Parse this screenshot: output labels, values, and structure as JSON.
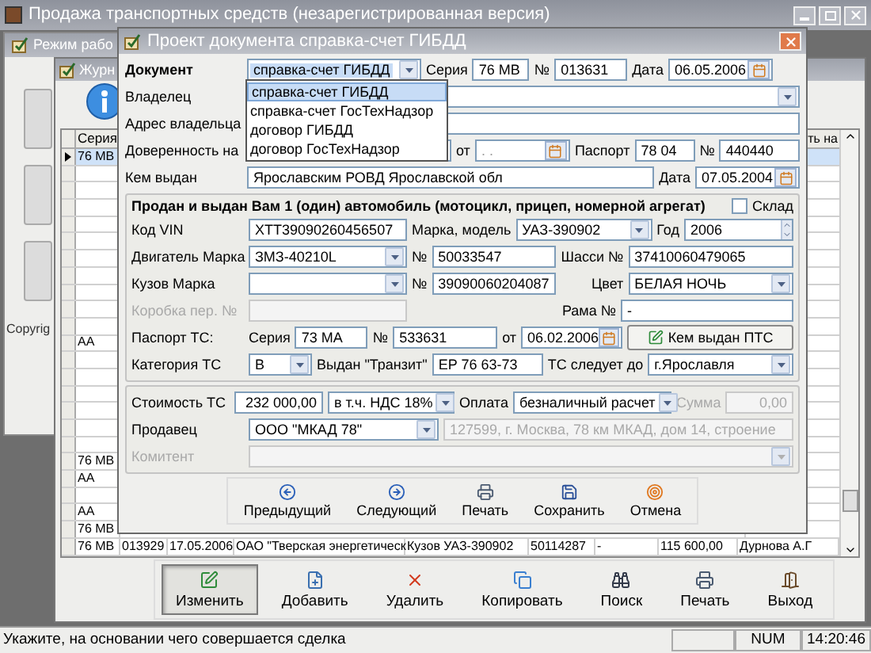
{
  "window": {
    "title": "Продажа транспортных средств (незарегистрированная версия)"
  },
  "mode_window": {
    "title": "Режим рабо",
    "footer": "Copyrig"
  },
  "journal": {
    "title": "Журн",
    "table": {
      "columns": [
        {
          "label": "Серия"
        },
        {
          "label": "ть на"
        }
      ],
      "rows": [
        {
          "series": "76 MB",
          "selected": true
        },
        {
          "selected": false
        },
        {
          "selected": false
        },
        {
          "selected": false
        },
        {
          "selected": false
        },
        {
          "selected": false
        },
        {
          "selected": false
        },
        {
          "selected": false
        },
        {
          "selected": false
        },
        {
          "selected": false
        },
        {
          "selected": false
        },
        {
          "series": "AA",
          "selected": false
        },
        {
          "selected": false
        },
        {
          "selected": false
        },
        {
          "selected": false
        },
        {
          "selected": false
        },
        {
          "selected": false
        },
        {
          "selected": false
        },
        {
          "series": "76 MB",
          "selected": false
        },
        {
          "series": "AA",
          "selected": false
        },
        {
          "selected": false
        },
        {
          "series": "AA",
          "selected": false
        },
        {
          "series": "76 MB",
          "selected": false
        },
        {
          "selected": false,
          "cells": [
            "76 MB",
            "013929",
            "17.05.2006",
            "ОАО \"Тверская энергетическ",
            "Кузов УАЗ-390902",
            "50114287",
            "-",
            "115 600,00",
            "Дурнова А.Г"
          ]
        }
      ]
    },
    "toolbar": [
      {
        "kind": "edit",
        "label": "Изменить",
        "pressed": true
      },
      {
        "kind": "add",
        "label": "Добавить",
        "pressed": false
      },
      {
        "kind": "delete",
        "label": "Удалить",
        "pressed": false
      },
      {
        "kind": "copy",
        "label": "Копировать",
        "pressed": false
      },
      {
        "kind": "search",
        "label": "Поиск",
        "pressed": false
      },
      {
        "kind": "print",
        "label": "Печать",
        "pressed": false
      },
      {
        "kind": "exit",
        "label": "Выход",
        "pressed": false
      }
    ]
  },
  "dialog": {
    "title": "Проект документа справка-счет ГИБДД",
    "sections": [
      {
        "rows": [
          {
            "items": [
              {
                "kind": "label",
                "text": "Документ",
                "bold": true
              },
              {
                "kind": "combo",
                "value": "справка-счет ГИБДД",
                "options": [
                  {
                    "label": "справка-счет ГИБДД",
                    "selected": true
                  },
                  {
                    "label": "справка-счет ГосТехНадзор",
                    "selected": false
                  },
                  {
                    "label": "договор ГИБДД",
                    "selected": false
                  },
                  {
                    "label": "договор ГосТехНадзор",
                    "selected": false
                  }
                ]
              },
              {
                "kind": "label",
                "text": "Серия"
              },
              {
                "kind": "field",
                "value": "76 MB"
              },
              {
                "kind": "label",
                "text": "№"
              },
              {
                "kind": "field",
                "value": "013631"
              },
              {
                "kind": "label",
                "text": "Дата"
              },
              {
                "kind": "date",
                "value": "06.05.2006"
              }
            ]
          },
          {
            "items": [
              {
                "kind": "label",
                "text": "Владелец"
              },
              {
                "kind": "combo"
              }
            ]
          },
          {
            "items": [
              {
                "kind": "label",
                "text": "Адрес владельца"
              },
              {
                "kind": "field"
              }
            ]
          },
          {
            "items": [
              {
                "kind": "label",
                "text": "Доверенность на"
              },
              {
                "kind": "field"
              },
              {
                "kind": "field"
              },
              {
                "kind": "label",
                "text": "от"
              },
              {
                "kind": "date",
                "placeholder": ". ."
              },
              {
                "kind": "label",
                "text": "Паспорт"
              },
              {
                "kind": "field",
                "value": "78 04"
              },
              {
                "kind": "label",
                "text": "№"
              },
              {
                "kind": "field",
                "value": "440440"
              }
            ]
          },
          {
            "items": [
              {
                "kind": "label",
                "text": "Кем выдан"
              },
              {
                "kind": "field",
                "value": "Ярославским РОВД Ярославской обл"
              },
              {
                "kind": "label",
                "text": "Дата"
              },
              {
                "kind": "date",
                "value": "07.05.2004"
              }
            ]
          }
        ]
      },
      {
        "title": "Продан и выдан Вам 1 (один) автомобиль (мотоцикл, прицеп, номерной агрегат)",
        "checkbox": {
          "label": "Склад",
          "checked": false
        },
        "rows": [
          {
            "items": [
              {
                "kind": "label",
                "text": "Код VIN"
              },
              {
                "kind": "field",
                "value": "XTT39090260456507"
              },
              {
                "kind": "label",
                "text": "Марка, модель"
              },
              {
                "kind": "combo",
                "value": "УАЗ-390902"
              },
              {
                "kind": "label",
                "text": "Год"
              },
              {
                "kind": "spin",
                "value": "2006"
              }
            ]
          },
          {
            "items": [
              {
                "kind": "label",
                "text": "Двигатель Марка"
              },
              {
                "kind": "combo",
                "value": "ЗМЗ-40210L"
              },
              {
                "kind": "label",
                "text": "№"
              },
              {
                "kind": "field",
                "value": "50033547"
              },
              {
                "kind": "label",
                "text": "Шасси №"
              },
              {
                "kind": "field",
                "value": "37410060479065"
              }
            ]
          },
          {
            "items": [
              {
                "kind": "label",
                "text": "Кузов Марка"
              },
              {
                "kind": "combo"
              },
              {
                "kind": "label",
                "text": "№"
              },
              {
                "kind": "field",
                "value": "39090060204087"
              },
              {
                "kind": "label",
                "text": "Цвет"
              },
              {
                "kind": "combo",
                "value": "БЕЛАЯ НОЧЬ"
              }
            ]
          },
          {
            "items": [
              {
                "kind": "label",
                "text": "Коробка пер. №",
                "disabled": true
              },
              {
                "kind": "field",
                "disabled": true
              },
              {
                "kind": "label",
                "text": "Рама №"
              },
              {
                "kind": "field",
                "value": "-"
              }
            ]
          },
          {
            "items": [
              {
                "kind": "label",
                "text": "Паспорт ТС:"
              },
              {
                "kind": "label",
                "text": "Серия"
              },
              {
                "kind": "field",
                "value": "73 MA"
              },
              {
                "kind": "label",
                "text": "№"
              },
              {
                "kind": "field",
                "value": "533631"
              },
              {
                "kind": "label",
                "text": "от"
              },
              {
                "kind": "date",
                "value": "06.02.2006"
              },
              {
                "kind": "button",
                "text": "Кем выдан ПТС"
              }
            ]
          },
          {
            "items": [
              {
                "kind": "label",
                "text": "Категория ТС"
              },
              {
                "kind": "combo",
                "value": "B"
              },
              {
                "kind": "label",
                "text": "Выдан \"Транзит\""
              },
              {
                "kind": "field",
                "value": "EP 76 63-73"
              },
              {
                "kind": "label",
                "text": "ТС следует до"
              },
              {
                "kind": "combo",
                "value": "г.Ярославля"
              }
            ]
          }
        ]
      },
      {
        "rows": [
          {
            "items": [
              {
                "kind": "label",
                "text": "Стоимость ТС"
              },
              {
                "kind": "amount",
                "value": "232 000,00"
              },
              {
                "kind": "combo",
                "value": "в т.ч. НДС 18%"
              },
              {
                "kind": "label",
                "text": "Оплата"
              },
              {
                "kind": "combo",
                "value": "безналичный расчет"
              },
              {
                "kind": "label",
                "text": "Сумма",
                "disabled": true
              },
              {
                "kind": "amount",
                "value": "0,00",
                "disabled": true
              }
            ]
          },
          {
            "items": [
              {
                "kind": "label",
                "text": "Продавец"
              },
              {
                "kind": "combo",
                "value": "ООО \"МКАД 78\""
              },
              {
                "kind": "field",
                "value": "127599, г. Москва, 78 км МКАД, дом 14, строение",
                "disabled": true
              }
            ]
          },
          {
            "items": [
              {
                "kind": "label",
                "text": "Комитент",
                "disabled": true
              },
              {
                "kind": "combo",
                "disabled": true
              }
            ]
          }
        ]
      }
    ],
    "buttons": [
      {
        "kind": "prev",
        "label": "Предыдущий"
      },
      {
        "kind": "next",
        "label": "Следующий"
      },
      {
        "kind": "print",
        "label": "Печать"
      },
      {
        "kind": "save",
        "label": "Сохранить"
      },
      {
        "kind": "cancel",
        "label": "Отмена"
      }
    ]
  },
  "status_bar": {
    "message": "Укажите, на основании чего совершается сделка",
    "num": "NUM",
    "time": "14:20:46"
  }
}
